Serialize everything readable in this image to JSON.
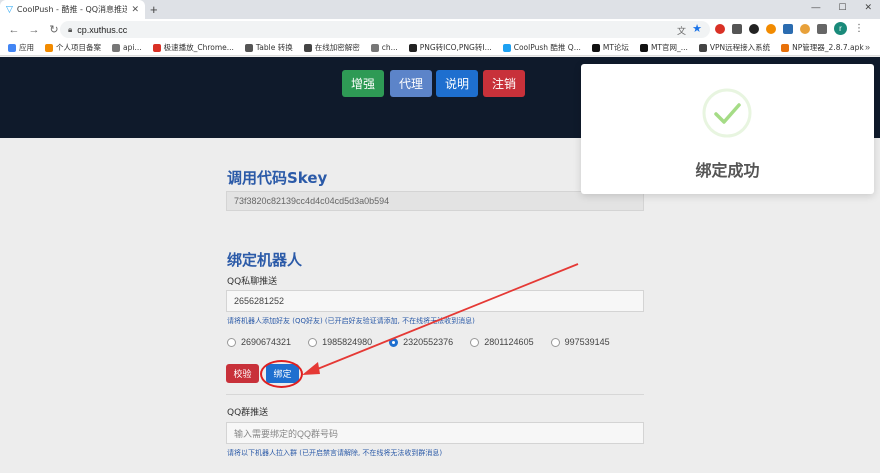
{
  "browser": {
    "tab_title": "CoolPush - 酷推 - QQ消息推送",
    "url": "cp.xuthus.cc",
    "avatar_letter": "r",
    "bookmarks": [
      {
        "label": "应用",
        "color": "#4285f4"
      },
      {
        "label": "个人项目备案",
        "color": "#f28b00"
      },
      {
        "label": "api...",
        "color": "#777777"
      },
      {
        "label": "极速播放_Chrome...",
        "color": "#d93025"
      },
      {
        "label": "Table 转换",
        "color": "#555555"
      },
      {
        "label": "在线加密解密",
        "color": "#444444"
      },
      {
        "label": "ch...",
        "color": "#777777"
      },
      {
        "label": "PNG转ICO,PNG转I...",
        "color": "#222222"
      },
      {
        "label": "CoolPush 酷推 Q...",
        "color": "#1da1f2"
      },
      {
        "label": "MT论坛",
        "color": "#111111"
      },
      {
        "label": "MT官网_...",
        "color": "#111111"
      },
      {
        "label": "VPN远程接入系统",
        "color": "#444444"
      },
      {
        "label": "NP管理器_2.8.7.apk",
        "color": "#e8710a"
      }
    ]
  },
  "nav": {
    "enhance": "增强",
    "proxy": "代理",
    "docs": "说明",
    "logout": "注销"
  },
  "skey": {
    "title": "调用代码Skey",
    "value": "73f3820c82139cc4d4c04cd5d3a0b594"
  },
  "bind": {
    "title": "绑定机器人",
    "private_label": "QQ私聊推送",
    "private_value": "2656281252",
    "private_hint": "请将机器人添加好友 (QQ好友) (已开启好友验证请添加, 不在线将无法收到消息)",
    "bots": [
      "2690674321",
      "1985824980",
      "2320552376",
      "2801124605",
      "997539145"
    ],
    "selected_bot": "2320552376",
    "check_label": "校验",
    "bind_label": "绑定",
    "group_label": "QQ群推送",
    "group_placeholder": "输入需要绑定的QQ群号码",
    "group_hint": "请将以下机器人拉入群 (已开启禁言请解除, 不在线将无法收到群消息)"
  },
  "toast": {
    "message": "绑定成功",
    "accent": "#a5dc86"
  }
}
